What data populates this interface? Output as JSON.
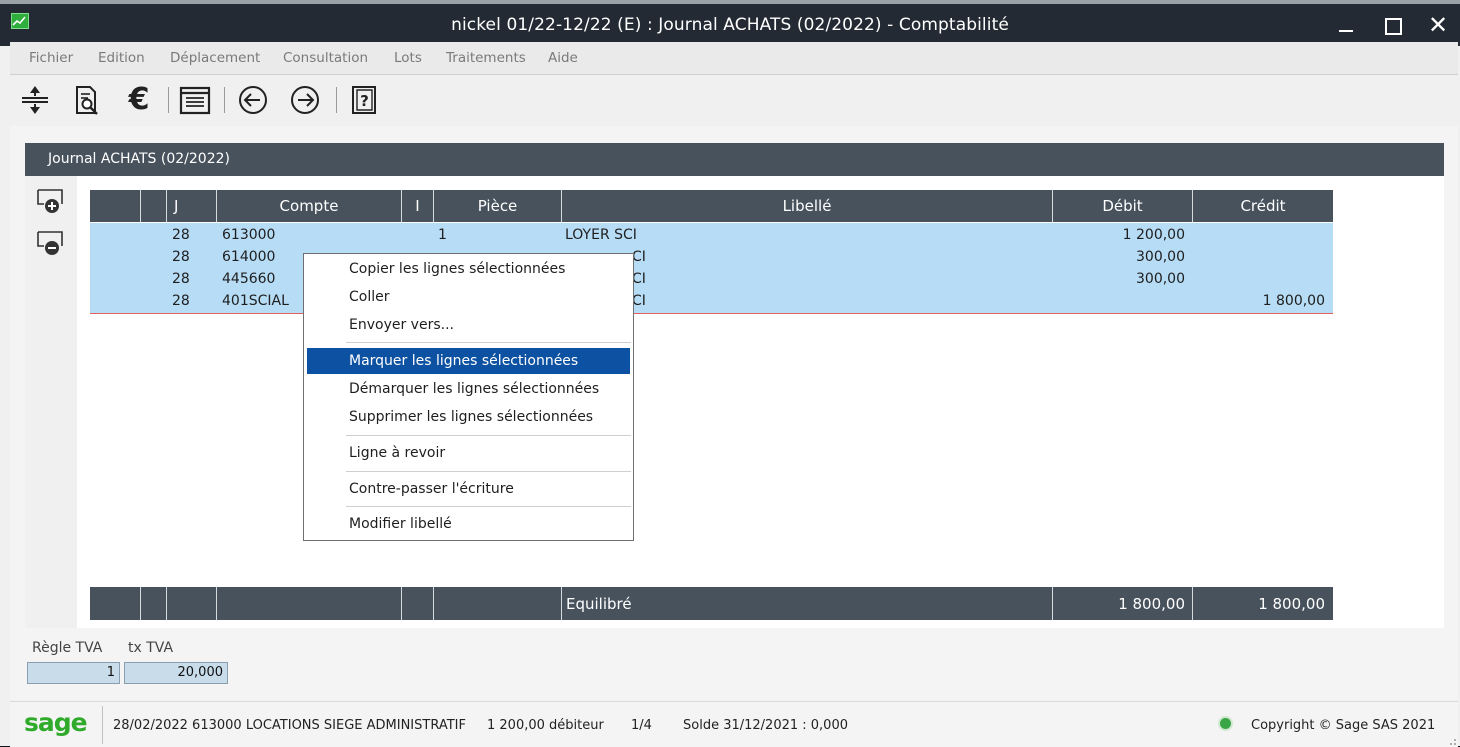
{
  "window": {
    "title": "nickel  01/22-12/22 (E) : Journal ACHATS (02/2022)  - Comptabilité"
  },
  "menu": [
    "Fichier",
    "Edition",
    "Déplacement",
    "Consultation",
    "Lots",
    "Traitements",
    "Aide"
  ],
  "toolbar": {
    "icons": [
      "expand-rows-icon",
      "document-search-icon",
      "euro-icon",
      "list-view-icon",
      "previous-icon",
      "next-icon",
      "help-icon"
    ]
  },
  "journal": {
    "header": "Journal ACHATS (02/2022)",
    "columns": [
      "J",
      "Compte",
      "I",
      "Pièce",
      "Libellé",
      "Débit",
      "Crédit"
    ],
    "rows": [
      {
        "j": "28",
        "compte": "613000",
        "piece": "1",
        "libelle": "LOYER SCI",
        "debit": "1 200,00",
        "credit": ""
      },
      {
        "j": "28",
        "compte": "614000",
        "piece": "",
        "libelle": "CI",
        "debit": "300,00",
        "credit": ""
      },
      {
        "j": "28",
        "compte": "445660",
        "piece": "",
        "libelle": "CI",
        "debit": "300,00",
        "credit": ""
      },
      {
        "j": "28",
        "compte": "401SCIAL",
        "piece": "",
        "libelle": "CI",
        "debit": "",
        "credit": "1 800,00"
      }
    ],
    "footer": {
      "label": "Equilibré",
      "debit": "1 800,00",
      "credit": "1 800,00"
    }
  },
  "context_menu": {
    "items": [
      "Copier les lignes sélectionnées",
      "Coller",
      "Envoyer vers...",
      "Marquer les lignes sélectionnées",
      "Démarquer les lignes sélectionnées",
      "Supprimer les lignes sélectionnées",
      "Ligne à revoir",
      "Contre-passer l'écriture",
      "Modifier libellé"
    ],
    "highlighted": "Marquer les lignes sélectionnées"
  },
  "tva": {
    "regle_label": "Règle TVA",
    "tx_label": "tx TVA",
    "regle_value": "1",
    "tx_value": "20,000"
  },
  "status": {
    "logo": "sage",
    "account_info": "28/02/2022 613000 LOCATIONS SIEGE ADMINISTRATIF",
    "balance": "1 200,00 débiteur",
    "position": "1/4",
    "solde": "Solde 31/12/2021 : 0,000",
    "copyright": "Copyright © Sage SAS 2021"
  },
  "colors": {
    "titlebar": "#232a33",
    "grid_header": "#47525d",
    "selection": "#b7dcf5",
    "menu_highlight": "#0c51a2",
    "sage_green": "#2faa2a"
  }
}
